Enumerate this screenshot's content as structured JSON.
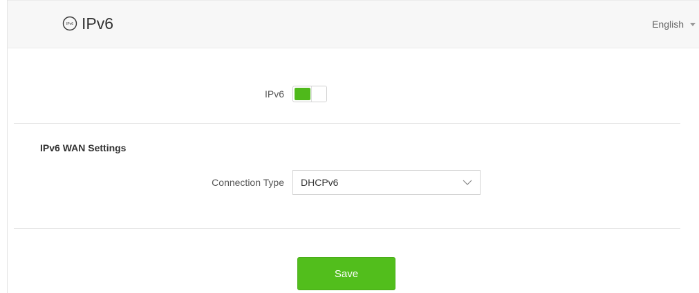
{
  "header": {
    "title": "IPv6",
    "icon_text": "IPv6",
    "language": "English",
    "icon": "ipv6-circle-icon"
  },
  "ipv6_toggle": {
    "label": "IPv6",
    "enabled": true
  },
  "wan_settings": {
    "section_title": "IPv6 WAN Settings",
    "connection_type_label": "Connection Type",
    "connection_type_value": "DHCPv6"
  },
  "actions": {
    "save_label": "Save"
  },
  "colors": {
    "accent_green": "#52be1c",
    "header_bg": "#f7f7f7"
  }
}
